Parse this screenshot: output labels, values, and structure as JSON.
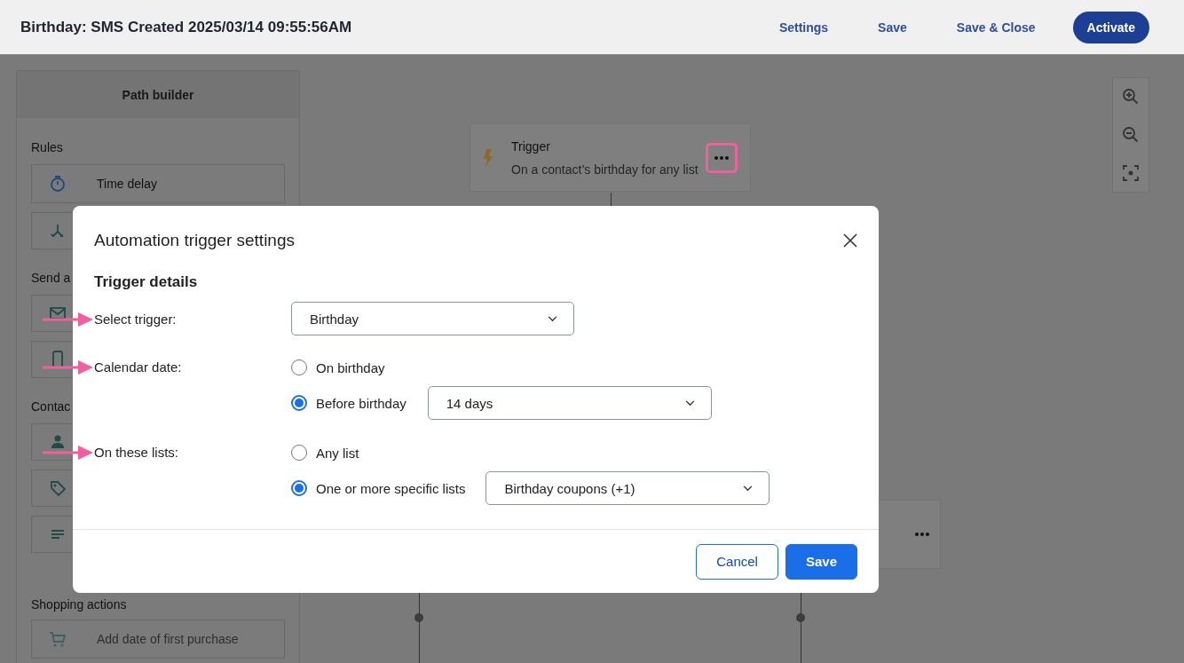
{
  "header": {
    "title": "Birthday: SMS Created 2025/03/14 09:55:56AM",
    "actions": [
      {
        "label": "Settings",
        "kind": "link"
      },
      {
        "label": "Save",
        "kind": "link"
      },
      {
        "label": "Save & Close",
        "kind": "link"
      },
      {
        "label": "Activate",
        "kind": "primary"
      }
    ]
  },
  "sidebar": {
    "title": "Path builder",
    "sections": [
      {
        "heading": "Rules",
        "items": [
          {
            "label": "Time delay",
            "disabled": false
          },
          {
            "disabled": false
          }
        ]
      },
      {
        "heading": "Send a",
        "items": [
          {
            "disabled": false
          },
          {
            "disabled": false
          }
        ]
      },
      {
        "heading": "Contac",
        "items": [
          {
            "disabled": false
          },
          {
            "disabled": false
          },
          {
            "disabled": false
          }
        ]
      },
      {
        "heading": "Shopping actions",
        "items": [
          {
            "label": "Add date of first purchase",
            "disabled": true
          }
        ]
      }
    ]
  },
  "canvas": {
    "trigger_card": {
      "title": "Trigger",
      "description": "On a contact’s birthday for any list",
      "menu_highlighted": true
    }
  },
  "dialog": {
    "title": "Automation trigger settings",
    "section": "Trigger details",
    "rows": [
      {
        "label": "Select trigger:",
        "pointed": true,
        "kind": "select",
        "value": "Birthday"
      },
      {
        "label": "Calendar date:",
        "pointed": true,
        "kind": "radios",
        "options": [
          {
            "label": "On birthday",
            "selected": false
          },
          {
            "label": "Before birthday",
            "selected": true,
            "value": "14 days"
          }
        ]
      },
      {
        "label": "On these lists:",
        "pointed": true,
        "kind": "radios",
        "options": [
          {
            "label": "Any list",
            "selected": false
          },
          {
            "label": "One or more specific lists",
            "selected": true,
            "value": "Birthday coupons (+1)"
          }
        ]
      }
    ],
    "buttons": [
      {
        "label": "Cancel",
        "kind": "secondary"
      },
      {
        "label": "Save",
        "kind": "primary"
      }
    ]
  }
}
